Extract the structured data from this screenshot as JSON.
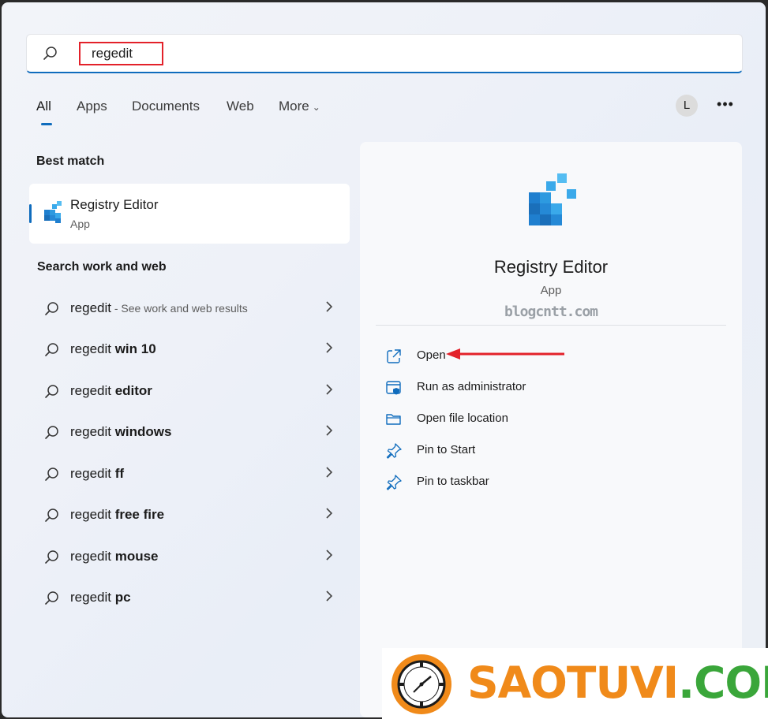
{
  "search": {
    "value": "regedit"
  },
  "tabs": [
    {
      "label": "All"
    },
    {
      "label": "Apps"
    },
    {
      "label": "Documents"
    },
    {
      "label": "Web"
    },
    {
      "label": "More"
    }
  ],
  "account": {
    "initial": "L"
  },
  "best_match": {
    "heading": "Best match",
    "title": "Registry Editor",
    "subtitle": "App"
  },
  "web_section": {
    "heading": "Search work and web",
    "items": [
      {
        "prefix": "regedit",
        "bold": "",
        "hint": " - See work and web results"
      },
      {
        "prefix": "regedit ",
        "bold": "win 10",
        "hint": ""
      },
      {
        "prefix": "regedit ",
        "bold": "editor",
        "hint": ""
      },
      {
        "prefix": "regedit ",
        "bold": "windows",
        "hint": ""
      },
      {
        "prefix": "regedit ",
        "bold": "ff",
        "hint": ""
      },
      {
        "prefix": "regedit ",
        "bold": "free fire",
        "hint": ""
      },
      {
        "prefix": "regedit ",
        "bold": "mouse",
        "hint": ""
      },
      {
        "prefix": "regedit ",
        "bold": "pc",
        "hint": ""
      }
    ]
  },
  "detail": {
    "title": "Registry Editor",
    "subtitle": "App",
    "watermark": "blogcntt.com",
    "actions": [
      {
        "label": "Open",
        "icon": "open-external-icon"
      },
      {
        "label": "Run as administrator",
        "icon": "shield-admin-icon"
      },
      {
        "label": "Open file location",
        "icon": "folder-icon"
      },
      {
        "label": "Pin to Start",
        "icon": "pin-icon"
      },
      {
        "label": "Pin to taskbar",
        "icon": "pin-icon"
      }
    ]
  },
  "brand": {
    "part1": "SAOTUVI",
    "part2": ".COM"
  },
  "colors": {
    "accent": "#0f6cbd",
    "highlight_red": "#e3212a",
    "brand_orange": "#f08a1a",
    "brand_green": "#3aa63a"
  }
}
